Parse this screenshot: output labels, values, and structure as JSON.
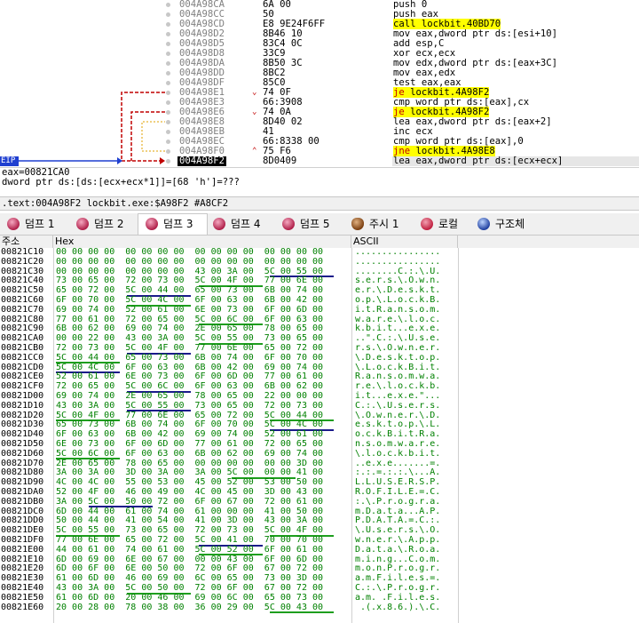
{
  "disasm": {
    "rows": [
      {
        "addr": "004A98CA",
        "arrow": "",
        "bytes": "6A 00",
        "instr": "push 0",
        "style": ""
      },
      {
        "addr": "004A98CC",
        "arrow": "",
        "bytes": "50",
        "instr": "push eax",
        "style": ""
      },
      {
        "addr": "004A98CD",
        "arrow": "",
        "bytes": "E8 9E24F6FF",
        "instr": "call lockbit.40BD70",
        "style": "call"
      },
      {
        "addr": "004A98D2",
        "arrow": "",
        "bytes": "8B46 10",
        "instr": "mov eax,dword ptr ds:[esi+10]",
        "style": ""
      },
      {
        "addr": "004A98D5",
        "arrow": "",
        "bytes": "83C4 0C",
        "instr": "add esp,C",
        "style": ""
      },
      {
        "addr": "004A98D8",
        "arrow": "",
        "bytes": "33C9",
        "instr": "xor ecx,ecx",
        "style": ""
      },
      {
        "addr": "004A98DA",
        "arrow": "",
        "bytes": "8B50 3C",
        "instr": "mov edx,dword ptr ds:[eax+3C]",
        "style": ""
      },
      {
        "addr": "004A98DD",
        "arrow": "",
        "bytes": "8BC2",
        "instr": "mov eax,edx",
        "style": ""
      },
      {
        "addr": "004A98DF",
        "arrow": "",
        "bytes": "85C0",
        "instr": "test eax,eax",
        "style": ""
      },
      {
        "addr": "004A98E1",
        "arrow": "v",
        "bytes": "74 0F",
        "instr": "je lockbit.4A98F2",
        "style": "jmp"
      },
      {
        "addr": "004A98E3",
        "arrow": "",
        "bytes": "66:3908",
        "instr": "cmp word ptr ds:[eax],cx",
        "style": ""
      },
      {
        "addr": "004A98E6",
        "arrow": "v",
        "bytes": "74 0A",
        "instr": "je lockbit.4A98F2",
        "style": "jmp"
      },
      {
        "addr": "004A98E8",
        "arrow": "",
        "bytes": "8D40 02",
        "instr": "lea eax,dword ptr ds:[eax+2]",
        "style": ""
      },
      {
        "addr": "004A98EB",
        "arrow": "",
        "bytes": "41",
        "instr": "inc ecx",
        "style": ""
      },
      {
        "addr": "004A98EC",
        "arrow": "",
        "bytes": "66:8338 00",
        "instr": "cmp word ptr ds:[eax],0",
        "style": ""
      },
      {
        "addr": "004A98F0",
        "arrow": "^",
        "bytes": "75 F6",
        "instr": "jne lockbit.4A98E8",
        "style": "jmp"
      },
      {
        "addr": "004A98F2",
        "arrow": "",
        "bytes": "8D0409",
        "instr": "lea eax,dword ptr ds:[ecx+ecx]",
        "style": "cur"
      }
    ],
    "eip_label": "EIP"
  },
  "info": {
    "line1": "eax=00821CA0",
    "line2": "dword ptr ds:[ds:[ecx+ecx*1]]=[68 'h']=???"
  },
  "address_bar": ".text:004A98F2 lockbit.exe:$A98F2 #A8CF2",
  "tabs": [
    {
      "label": "덤프 1",
      "icon": "dump-icon",
      "active": false
    },
    {
      "label": "덤프 2",
      "icon": "dump-icon",
      "active": false
    },
    {
      "label": "덤프 3",
      "icon": "dump-icon",
      "active": true
    },
    {
      "label": "덤프 4",
      "icon": "dump-icon",
      "active": false
    },
    {
      "label": "덤프 5",
      "icon": "dump-icon",
      "active": false
    },
    {
      "label": "주시 1",
      "icon": "watch-icon",
      "active": false
    },
    {
      "label": "로컬",
      "icon": "locals-icon",
      "active": false
    },
    {
      "label": "구조체",
      "icon": "struct-icon",
      "active": false
    }
  ],
  "hex_header": {
    "address": "주소",
    "hex": "Hex",
    "ascii": "ASCII"
  },
  "hex_rows": [
    {
      "addr": "00821C10",
      "hex": "00 00 00 00 00 00 00 00 00 00 00 00 00 00 00 00",
      "ascii": "................"
    },
    {
      "addr": "00821C20",
      "hex": "00 00 00 00 00 00 00 00 00 00 00 00 00 00 00 00",
      "ascii": "................"
    },
    {
      "addr": "00821C30",
      "hex": "00 00 00 00 00 00 00 00 43 00 3A 00 5C 00 55 00",
      "ascii": "........C.:.\\.U."
    },
    {
      "addr": "00821C40",
      "hex": "73 00 65 00 72 00 73 00 5C 00 4F 00 77 00 6E 00",
      "ascii": "s.e.r.s.\\.O.w.n."
    },
    {
      "addr": "00821C50",
      "hex": "65 00 72 00 5C 00 44 00 65 00 73 00 6B 00 74 00",
      "ascii": "e.r.\\.D.e.s.k.t."
    },
    {
      "addr": "00821C60",
      "hex": "6F 00 70 00 5C 00 4C 00 6F 00 63 00 6B 00 42 00",
      "ascii": "o.p.\\.L.o.c.k.B."
    },
    {
      "addr": "00821C70",
      "hex": "69 00 74 00 52 00 61 00 6E 00 73 00 6F 00 6D 00",
      "ascii": "i.t.R.a.n.s.o.m."
    },
    {
      "addr": "00821C80",
      "hex": "77 00 61 00 72 00 65 00 5C 00 6C 00 6F 00 63 00",
      "ascii": "w.a.r.e.\\.l.o.c."
    },
    {
      "addr": "00821C90",
      "hex": "6B 00 62 00 69 00 74 00 2E 00 65 00 78 00 65 00",
      "ascii": "k.b.i.t...e.x.e."
    },
    {
      "addr": "00821CA0",
      "hex": "00 00 22 00 43 00 3A 00 5C 00 55 00 73 00 65 00",
      "ascii": "..\".C.:.\\.U.s.e."
    },
    {
      "addr": "00821CB0",
      "hex": "72 00 73 00 5C 00 4F 00 77 00 6E 00 65 00 72 00",
      "ascii": "r.s.\\.O.w.n.e.r."
    },
    {
      "addr": "00821CC0",
      "hex": "5C 00 44 00 65 00 73 00 6B 00 74 00 6F 00 70 00",
      "ascii": "\\.D.e.s.k.t.o.p."
    },
    {
      "addr": "00821CD0",
      "hex": "5C 00 4C 00 6F 00 63 00 6B 00 42 00 69 00 74 00",
      "ascii": "\\.L.o.c.k.B.i.t."
    },
    {
      "addr": "00821CE0",
      "hex": "52 00 61 00 6E 00 73 00 6F 00 6D 00 77 00 61 00",
      "ascii": "R.a.n.s.o.m.w.a."
    },
    {
      "addr": "00821CF0",
      "hex": "72 00 65 00 5C 00 6C 00 6F 00 63 00 6B 00 62 00",
      "ascii": "r.e.\\.l.o.c.k.b."
    },
    {
      "addr": "00821D00",
      "hex": "69 00 74 00 2E 00 65 00 78 00 65 00 22 00 00 00",
      "ascii": "i.t...e.x.e.\"..."
    },
    {
      "addr": "00821D10",
      "hex": "43 00 3A 00 5C 00 55 00 73 00 65 00 72 00 73 00",
      "ascii": "C.:.\\.U.s.e.r.s."
    },
    {
      "addr": "00821D20",
      "hex": "5C 00 4F 00 77 00 6E 00 65 00 72 00 5C 00 44 00",
      "ascii": "\\.O.w.n.e.r.\\.D."
    },
    {
      "addr": "00821D30",
      "hex": "65 00 73 00 6B 00 74 00 6F 00 70 00 5C 00 4C 00",
      "ascii": "e.s.k.t.o.p.\\.L."
    },
    {
      "addr": "00821D40",
      "hex": "6F 00 63 00 6B 00 42 00 69 00 74 00 52 00 61 00",
      "ascii": "o.c.k.B.i.t.R.a."
    },
    {
      "addr": "00821D50",
      "hex": "6E 00 73 00 6F 00 6D 00 77 00 61 00 72 00 65 00",
      "ascii": "n.s.o.m.w.a.r.e."
    },
    {
      "addr": "00821D60",
      "hex": "5C 00 6C 00 6F 00 63 00 6B 00 62 00 69 00 74 00",
      "ascii": "\\.l.o.c.k.b.i.t."
    },
    {
      "addr": "00821D70",
      "hex": "2E 00 65 00 78 00 65 00 00 00 00 00 00 00 3D 00",
      "ascii": "..e.x.e.......=."
    },
    {
      "addr": "00821D80",
      "hex": "3A 00 3A 00 3D 00 3A 00 3A 00 5C 00 00 00 41 00",
      "ascii": ":.:.=.:.:.\\...A."
    },
    {
      "addr": "00821D90",
      "hex": "4C 00 4C 00 55 00 53 00 45 00 52 00 53 00 50 00",
      "ascii": "L.L.U.S.E.R.S.P."
    },
    {
      "addr": "00821DA0",
      "hex": "52 00 4F 00 46 00 49 00 4C 00 45 00 3D 00 43 00",
      "ascii": "R.O.F.I.L.E.=.C."
    },
    {
      "addr": "00821DB0",
      "hex": "3A 00 5C 00 50 00 72 00 6F 00 67 00 72 00 61 00",
      "ascii": ":.\\.P.r.o.g.r.a."
    },
    {
      "addr": "00821DC0",
      "hex": "6D 00 44 00 61 00 74 00 61 00 00 00 41 00 50 00",
      "ascii": "m.D.a.t.a...A.P."
    },
    {
      "addr": "00821DD0",
      "hex": "50 00 44 00 41 00 54 00 41 00 3D 00 43 00 3A 00",
      "ascii": "P.D.A.T.A.=.C.:."
    },
    {
      "addr": "00821DE0",
      "hex": "5C 00 55 00 73 00 65 00 72 00 73 00 5C 00 4F 00",
      "ascii": "\\.U.s.e.r.s.\\.O."
    },
    {
      "addr": "00821DF0",
      "hex": "77 00 6E 00 65 00 72 00 5C 00 41 00 70 00 70 00",
      "ascii": "w.n.e.r.\\.A.p.p."
    },
    {
      "addr": "00821E00",
      "hex": "44 00 61 00 74 00 61 00 5C 00 52 00 6F 00 61 00",
      "ascii": "D.a.t.a.\\.R.o.a."
    },
    {
      "addr": "00821E10",
      "hex": "6D 00 69 00 6E 00 67 00 00 00 43 00 6F 00 6D 00",
      "ascii": "m.i.n.g...C.o.m."
    },
    {
      "addr": "00821E20",
      "hex": "6D 00 6F 00 6E 00 50 00 72 00 6F 00 67 00 72 00",
      "ascii": "m.o.n.P.r.o.g.r."
    },
    {
      "addr": "00821E30",
      "hex": "61 00 6D 00 46 00 69 00 6C 00 65 00 73 00 3D 00",
      "ascii": "a.m.F.i.l.e.s.=."
    },
    {
      "addr": "00821E40",
      "hex": "43 00 3A 00 5C 00 50 00 72 00 6F 00 67 00 72 00",
      "ascii": "C.:.\\.P.r.o.g.r."
    },
    {
      "addr": "00821E50",
      "hex": "61 00 6D 00 20 00 46 00 69 00 6C 00 65 00 73 00",
      "ascii": "a.m. .F.i.l.e.s."
    },
    {
      "addr": "00821E60",
      "hex": "20 00 28 00 78 00 38 00 36 00 29 00 5C 00 43 00",
      "ascii": " .(.x.8.6.).\\.C."
    }
  ],
  "colors": {
    "eip": "#1f3fd0",
    "jump_arrow": "#c00000",
    "call_bg": "#ffff00",
    "hex_text": "#008000"
  }
}
